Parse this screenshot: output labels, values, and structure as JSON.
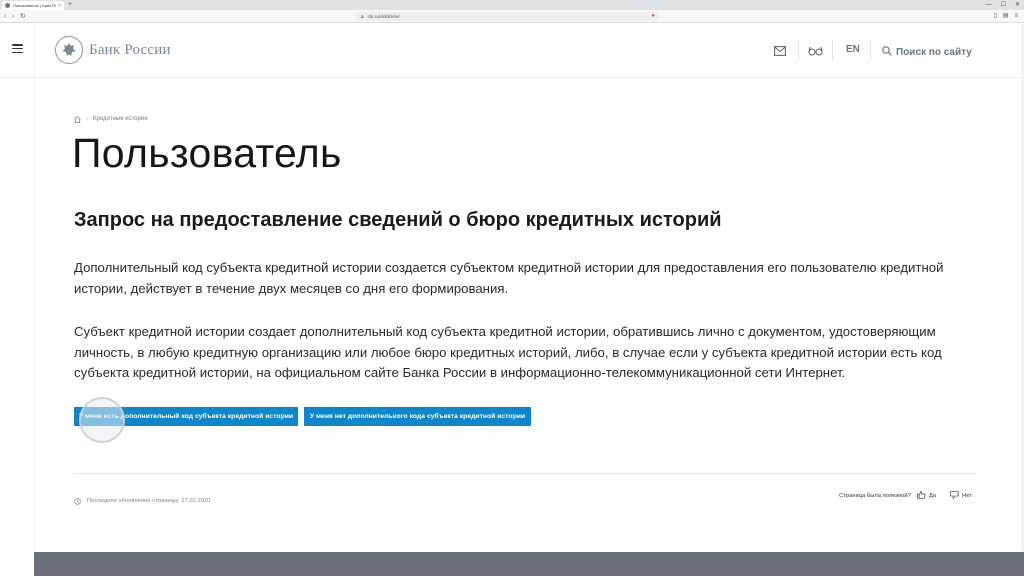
{
  "browser": {
    "tab_title": "Пользователь | Банк Ро...",
    "tab_close": "×",
    "new_tab": "+",
    "url": "cbr.ru/ckki/ckim/",
    "nav": {
      "back": "‹",
      "forward": "›",
      "reload": "↻"
    },
    "window_controls": [
      "—",
      "☐",
      "✕"
    ]
  },
  "header": {
    "logo_text": "Банк России",
    "lang": "EN",
    "search_label": "Поиск по сайту"
  },
  "breadcrumb": {
    "separator": "›",
    "item": "Кредитные истории"
  },
  "main": {
    "title": "Пользователь",
    "subtitle": "Запрос на предоставление сведений о бюро кредитных историй",
    "paragraph1": "Дополнительный код субъекта кредитной истории создается субъектом кредитной истории для предоставления его пользователю кредитной истории, действует в течение двух месяцев со дня его формирования.",
    "paragraph2": "Субъект кредитной истории создает дополнительный код субъекта кредитной истории, обратившись лично с документом, удостоверяющим личность, в любую кредитную организацию или любое бюро кредитных историй, либо, в случае если у субъекта кредитной истории есть код субъекта кредитной истории, на официальном сайте Банка России в информационно-телекоммуникационной сети Интернет.",
    "button_has_code": "У меня есть дополнительный код субъекта кредитной истории",
    "button_no_code": "У меня нет дополнительного кода субъекта кредитной истории"
  },
  "footer_meta": {
    "updated": "Последнее обновление страницы: 27.02.2020",
    "feedback_question": "Страница была полезной?",
    "yes": "Да",
    "no": "Нет"
  },
  "colors": {
    "accent": "#0f86c9",
    "logo": "#7a8796",
    "footer_band": "#6a6f77"
  },
  "icons": [
    "menu-icon",
    "bank-emblem-icon",
    "mail-icon",
    "glasses-icon",
    "search-icon",
    "home-icon",
    "clock-icon",
    "thumbs-up-icon",
    "thumbs-down-icon"
  ]
}
